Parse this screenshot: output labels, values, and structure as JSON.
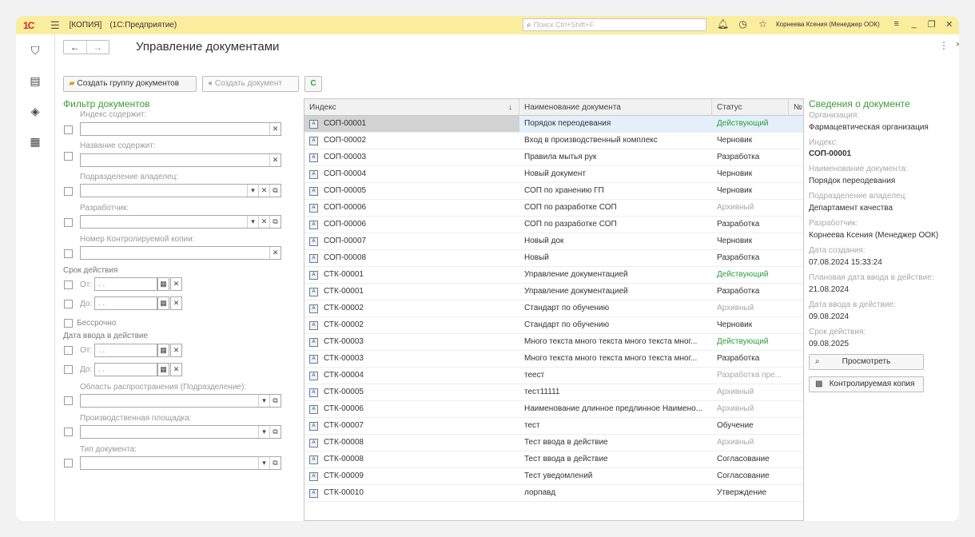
{
  "topbar": {
    "logo": "1С",
    "menu_icon": "menu-icon",
    "title_copy": "[КОПИЯ]",
    "title_app": "(1С:Предприятие)",
    "search_placeholder": "Поиск Ctrl+Shift+F",
    "user": "Корнеева Ксения (Менеджер ООК)",
    "icons": [
      "bell-icon",
      "history-icon",
      "star-icon",
      "settings-icon",
      "minimize-icon",
      "restore-icon",
      "close-icon"
    ]
  },
  "sidebar": {
    "icons": [
      "bookmark-icon",
      "documents-icon",
      "layers-icon",
      "presentation-icon"
    ]
  },
  "header": {
    "back": "←",
    "forward": "→",
    "title": "Управление документами",
    "more": "⋮",
    "close": "×"
  },
  "toolbar": {
    "create_group": "Создать группу документов",
    "create_doc": "Создать документ",
    "refresh": "C"
  },
  "filter": {
    "title": "Фильтр документов",
    "index_contains": "Индекс содержит:",
    "name_contains": "Название содержит:",
    "dept_owner": "Подразделение владелец:",
    "developer": "Разработчик:",
    "control_copy": "Номер Контролируемой копии:",
    "validity": "Срок действия",
    "from": "От:",
    "to": "До:",
    "date_placeholder": " .  .",
    "unlimited": "Бессрочно",
    "effective_date": "Дата ввода в действие",
    "scope": "Область распространения (Подразделение):",
    "production_site": "Производственная площадка:",
    "doc_type": "Тип документа:"
  },
  "table": {
    "columns": [
      "Индекс",
      "Наименование документа",
      "Статус",
      "№"
    ],
    "sort_arrow": "↓",
    "rows": [
      {
        "index": "СОП-00001",
        "name": "Порядок переодевания",
        "status": "Действующий",
        "kind": "active"
      },
      {
        "index": "СОП-00002",
        "name": "Вход в производственный комплекс",
        "status": "Черновик",
        "kind": "normal"
      },
      {
        "index": "СОП-00003",
        "name": "Правила мытья рук",
        "status": "Разработка",
        "kind": "normal"
      },
      {
        "index": "СОП-00004",
        "name": "Новый документ",
        "status": "Черновик",
        "kind": "normal"
      },
      {
        "index": "СОП-00005",
        "name": "СОП по хранению ГП",
        "status": "Черновик",
        "kind": "normal"
      },
      {
        "index": "СОП-00006",
        "name": "СОП по разработке СОП",
        "status": "Архивный",
        "kind": "archive"
      },
      {
        "index": "СОП-00006",
        "name": "СОП по разработке СОП",
        "status": "Разработка",
        "kind": "normal"
      },
      {
        "index": "СОП-00007",
        "name": "Новый док",
        "status": "Черновик",
        "kind": "normal"
      },
      {
        "index": "СОП-00008",
        "name": "Новый",
        "status": "Разработка",
        "kind": "normal"
      },
      {
        "index": "СТК-00001",
        "name": "Управление документацией",
        "status": "Действующий",
        "kind": "active"
      },
      {
        "index": "СТК-00001",
        "name": "Управление документацией",
        "status": "Разработка",
        "kind": "normal"
      },
      {
        "index": "СТК-00002",
        "name": "Стандарт по обучению",
        "status": "Архивный",
        "kind": "archive"
      },
      {
        "index": "СТК-00002",
        "name": "Стандарт по обучению",
        "status": "Черновик",
        "kind": "normal"
      },
      {
        "index": "СТК-00003",
        "name": "Много текста много текста много текста мног...",
        "status": "Действующий",
        "kind": "active"
      },
      {
        "index": "СТК-00003",
        "name": "Много текста много текста много текста мног...",
        "status": "Разработка",
        "kind": "normal"
      },
      {
        "index": "СТК-00004",
        "name": "теест",
        "status": "Разработка пре...",
        "kind": "archive"
      },
      {
        "index": "СТК-00005",
        "name": "тест11111",
        "status": "Архивный",
        "kind": "archive"
      },
      {
        "index": "СТК-00006",
        "name": "Наименование длинное предлинное Наимено...",
        "status": "Архивный",
        "kind": "archive"
      },
      {
        "index": "СТК-00007",
        "name": "тест",
        "status": "Обучение",
        "kind": "normal"
      },
      {
        "index": "СТК-00008",
        "name": "Тест ввода в действие",
        "status": "Архивный",
        "kind": "archive"
      },
      {
        "index": "СТК-00008",
        "name": "Тест ввода в действие",
        "status": "Согласование",
        "kind": "normal"
      },
      {
        "index": "СТК-00009",
        "name": "Тест уведомлений",
        "status": "Согласование",
        "kind": "normal"
      },
      {
        "index": "СТК-00010",
        "name": "лорпавд",
        "status": "Утверждение",
        "kind": "normal"
      }
    ]
  },
  "info": {
    "title": "Сведения о документе",
    "org_label": "Организация:",
    "org_value": "Фармацевтическая организация",
    "index_label": "Индекс:",
    "index_value": "СОП-00001",
    "name_label": "Наименование документа:",
    "name_value": "Порядок переодевания",
    "dept_label": "Подразделение владелец:",
    "dept_value": "Департамент качества",
    "dev_label": "Разработчик:",
    "dev_value": "Корнеева Ксения (Менеджер ООК)",
    "created_label": "Дата создания:",
    "created_value": "07.08.2024 15:33:24",
    "planned_label": "Плановая дата ввода в действие:",
    "planned_value": "21.08.2024",
    "effective_label": "Дата ввода в действие:",
    "effective_value": "09.08.2024",
    "validity_label": "Срок действия:",
    "validity_value": "09.08.2025",
    "view_btn": "Просмотреть",
    "copy_btn": "Контролируемая копия"
  }
}
